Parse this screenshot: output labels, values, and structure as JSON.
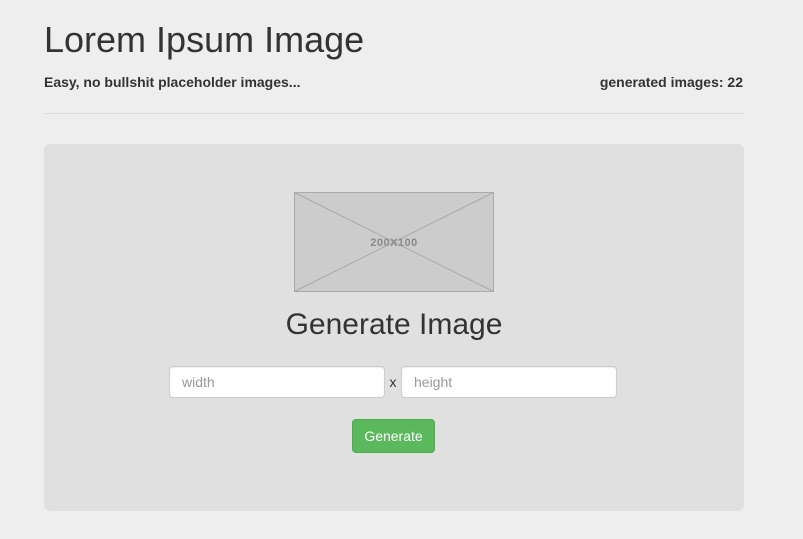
{
  "header": {
    "title": "Lorem Ipsum Image",
    "tagline": "Easy, no bullshit placeholder images...",
    "counter_text": "generated images: 22"
  },
  "preview": {
    "label": "200X100",
    "colors": {
      "fill": "#cccccc",
      "stroke": "#a9a9a9",
      "text": "#8a8a8a"
    }
  },
  "generator": {
    "heading": "Generate Image",
    "width_placeholder": "width",
    "height_placeholder": "height",
    "separator": "x",
    "button_label": "Generate",
    "button_color": "#5cb85c"
  }
}
